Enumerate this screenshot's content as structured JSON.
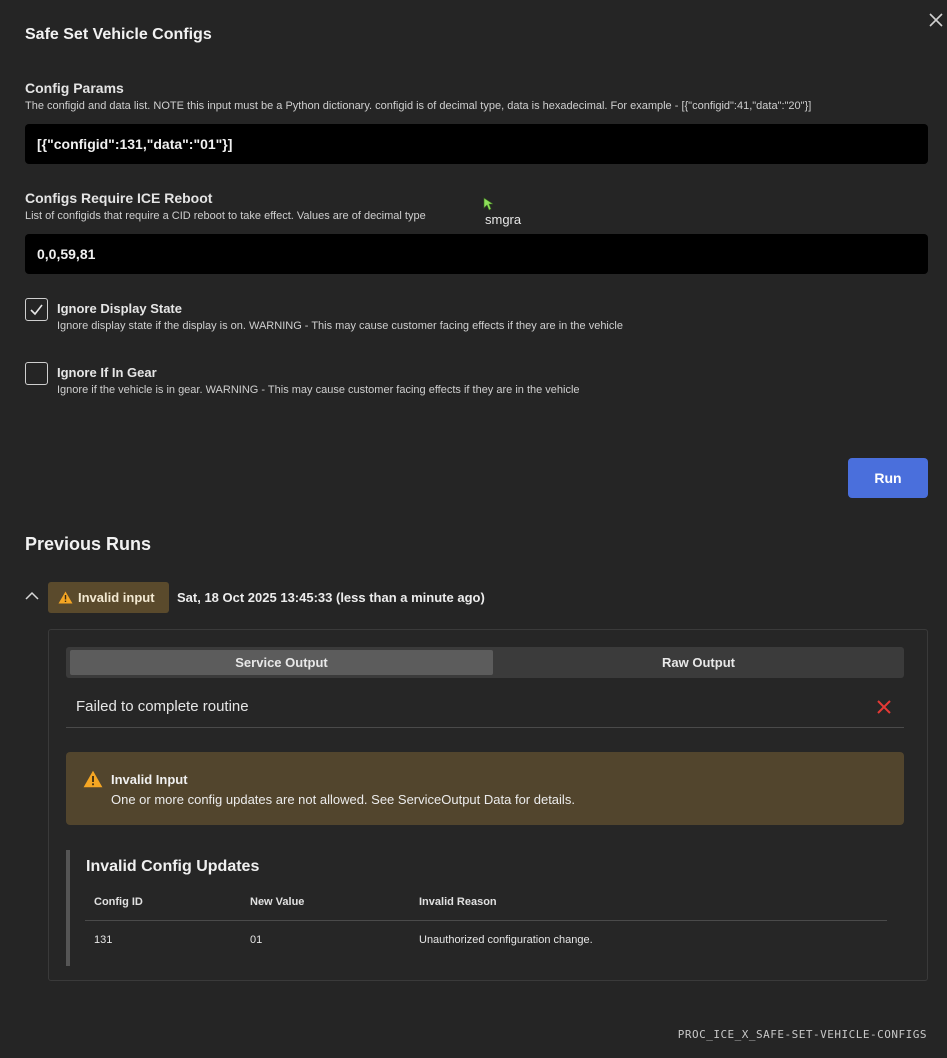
{
  "dialog": {
    "title": "Safe Set Vehicle Configs",
    "close_icon": "close-icon"
  },
  "config_params": {
    "label": "Config Params",
    "help": "The configid and data list. NOTE this input must be a Python dictionary. configid is of decimal type, data is hexadecimal. For example - [{\"configid\":41,\"data\":\"20\"}]",
    "value": "[{\"configid\":131,\"data\":\"01\"}]"
  },
  "reboot_configs": {
    "label": "Configs Require ICE Reboot",
    "help": "List of configids that require a CID reboot to take effect. Values are of decimal type",
    "value": "0,0,59,81"
  },
  "cursor": {
    "tag": "smgra"
  },
  "ignore_display": {
    "label": "Ignore Display State",
    "help": "Ignore display state if the display is on. WARNING - This may cause customer facing effects if they are in the vehicle",
    "checked": true
  },
  "ignore_gear": {
    "label": "Ignore If In Gear",
    "help": "Ignore if the vehicle is in gear. WARNING - This may cause customer facing effects if they are in the vehicle",
    "checked": false
  },
  "run_button": {
    "label": "Run",
    "color": "#4a6fdc"
  },
  "previous_runs": {
    "title": "Previous Runs",
    "run": {
      "status": "Invalid input",
      "timestamp": "Sat, 18 Oct 2025 13:45:33 (less than a minute ago)",
      "tabs": [
        "Service Output",
        "Raw Output"
      ],
      "active_tab": "Service Output",
      "routine_result": "Failed to complete routine",
      "alert": {
        "title": "Invalid Input",
        "message": "One or more config updates are not allowed. See ServiceOutput Data for details."
      },
      "updates": {
        "title": "Invalid Config Updates",
        "columns": [
          "Config ID",
          "New Value",
          "Invalid Reason"
        ],
        "rows": [
          [
            "131",
            "01",
            "Unauthorized configuration change."
          ]
        ]
      }
    }
  },
  "footer": {
    "procedure_id": "PROC_ICE_X_SAFE-SET-VEHICLE-CONFIGS"
  },
  "colors": {
    "background": "#252525",
    "warning_badge": "#5a4a2c",
    "warning_alert": "#52452d",
    "error_red": "#e53935",
    "warning_icon": "#f5a623"
  }
}
